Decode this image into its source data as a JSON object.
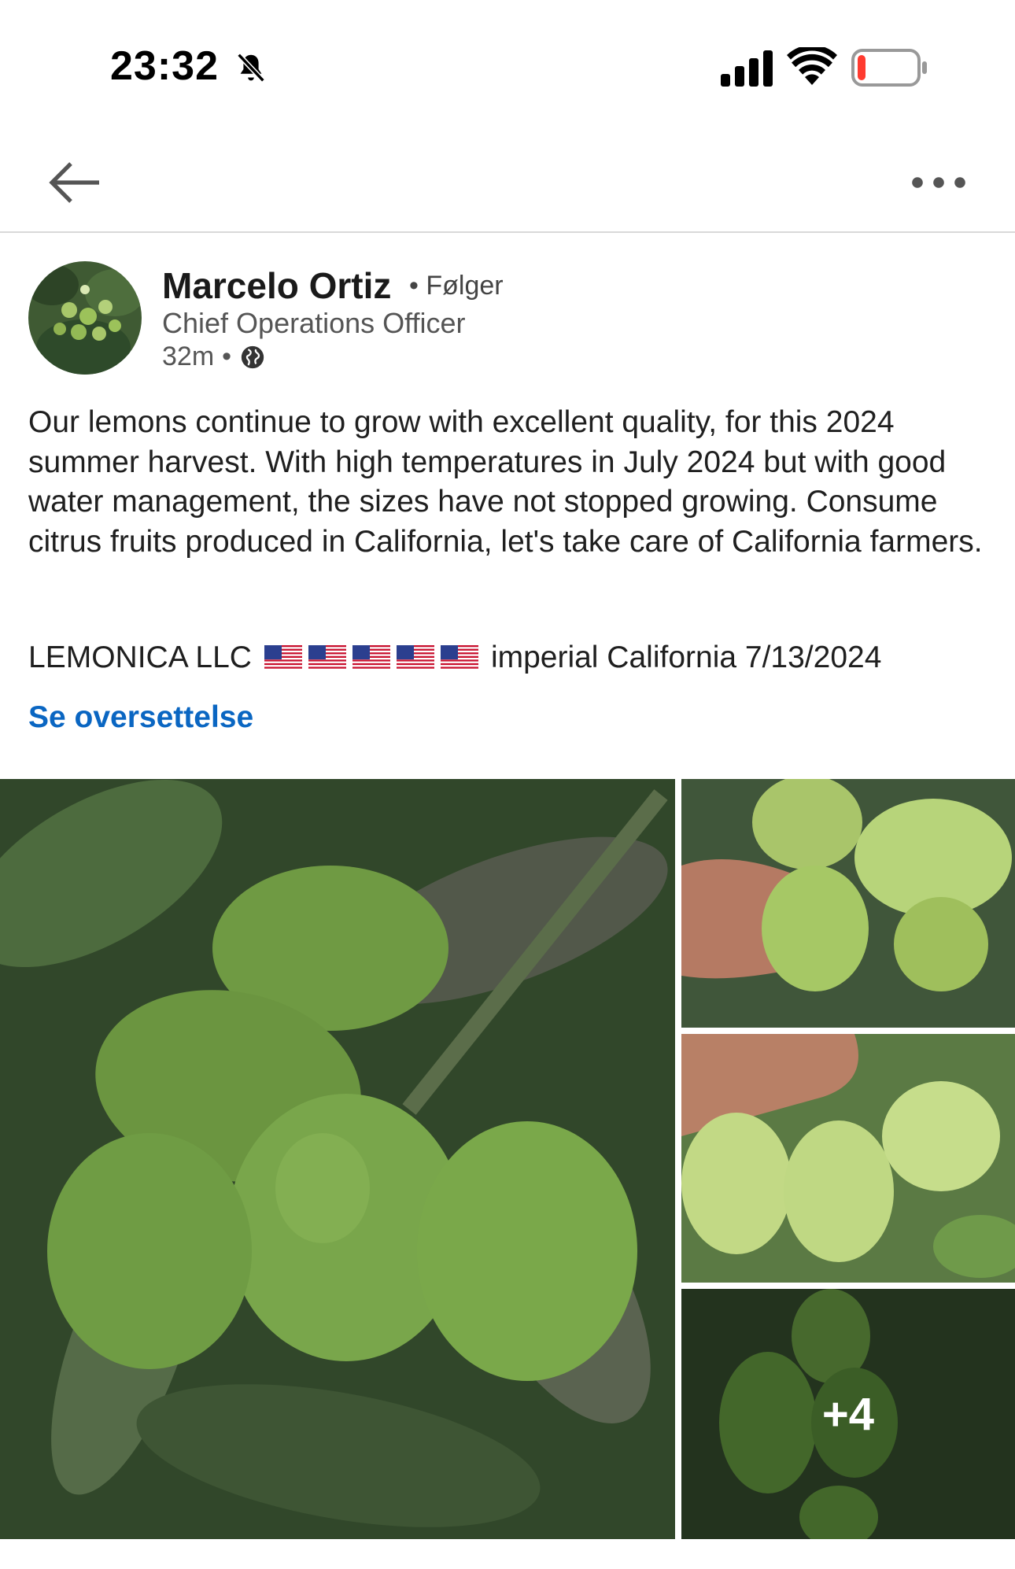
{
  "status": {
    "time": "23:32"
  },
  "nav": {},
  "author": {
    "name": "Marcelo Ortiz",
    "follow_label": "• Følger",
    "title": "Chief Operations Officer",
    "time_ago": "32m",
    "dot": "•"
  },
  "post": {
    "text": "Our lemons continue to grow with excellent quality, for this 2024 summer harvest. With high temperatures in July 2024 but with good water management, the sizes have not stopped growing. Consume citrus fruits produced in California, let's take care of California farmers.",
    "company": "LEMONICA LLC",
    "flags_count": 5,
    "location_date": "imperial California 7/13/2024",
    "translate_label": "Se oversettelse"
  },
  "gallery": {
    "extra_count": "+4"
  },
  "colors": {
    "link": "#0a66c2",
    "leaf": "#3c5a2f",
    "lemon": "#9cc25a"
  }
}
